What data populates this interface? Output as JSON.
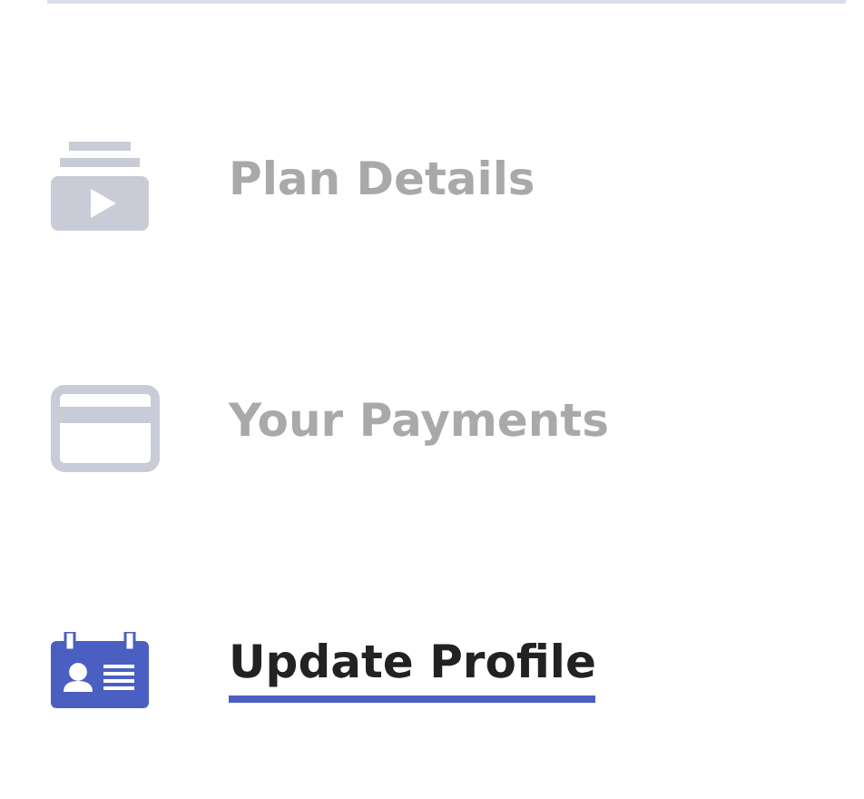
{
  "menu": [
    {
      "kind": "plan",
      "label": "Plan Details",
      "selected": false
    },
    {
      "kind": "payment",
      "label": "Your Payments",
      "selected": false
    },
    {
      "kind": "profile",
      "label": "Update Profile",
      "selected": true
    }
  ]
}
